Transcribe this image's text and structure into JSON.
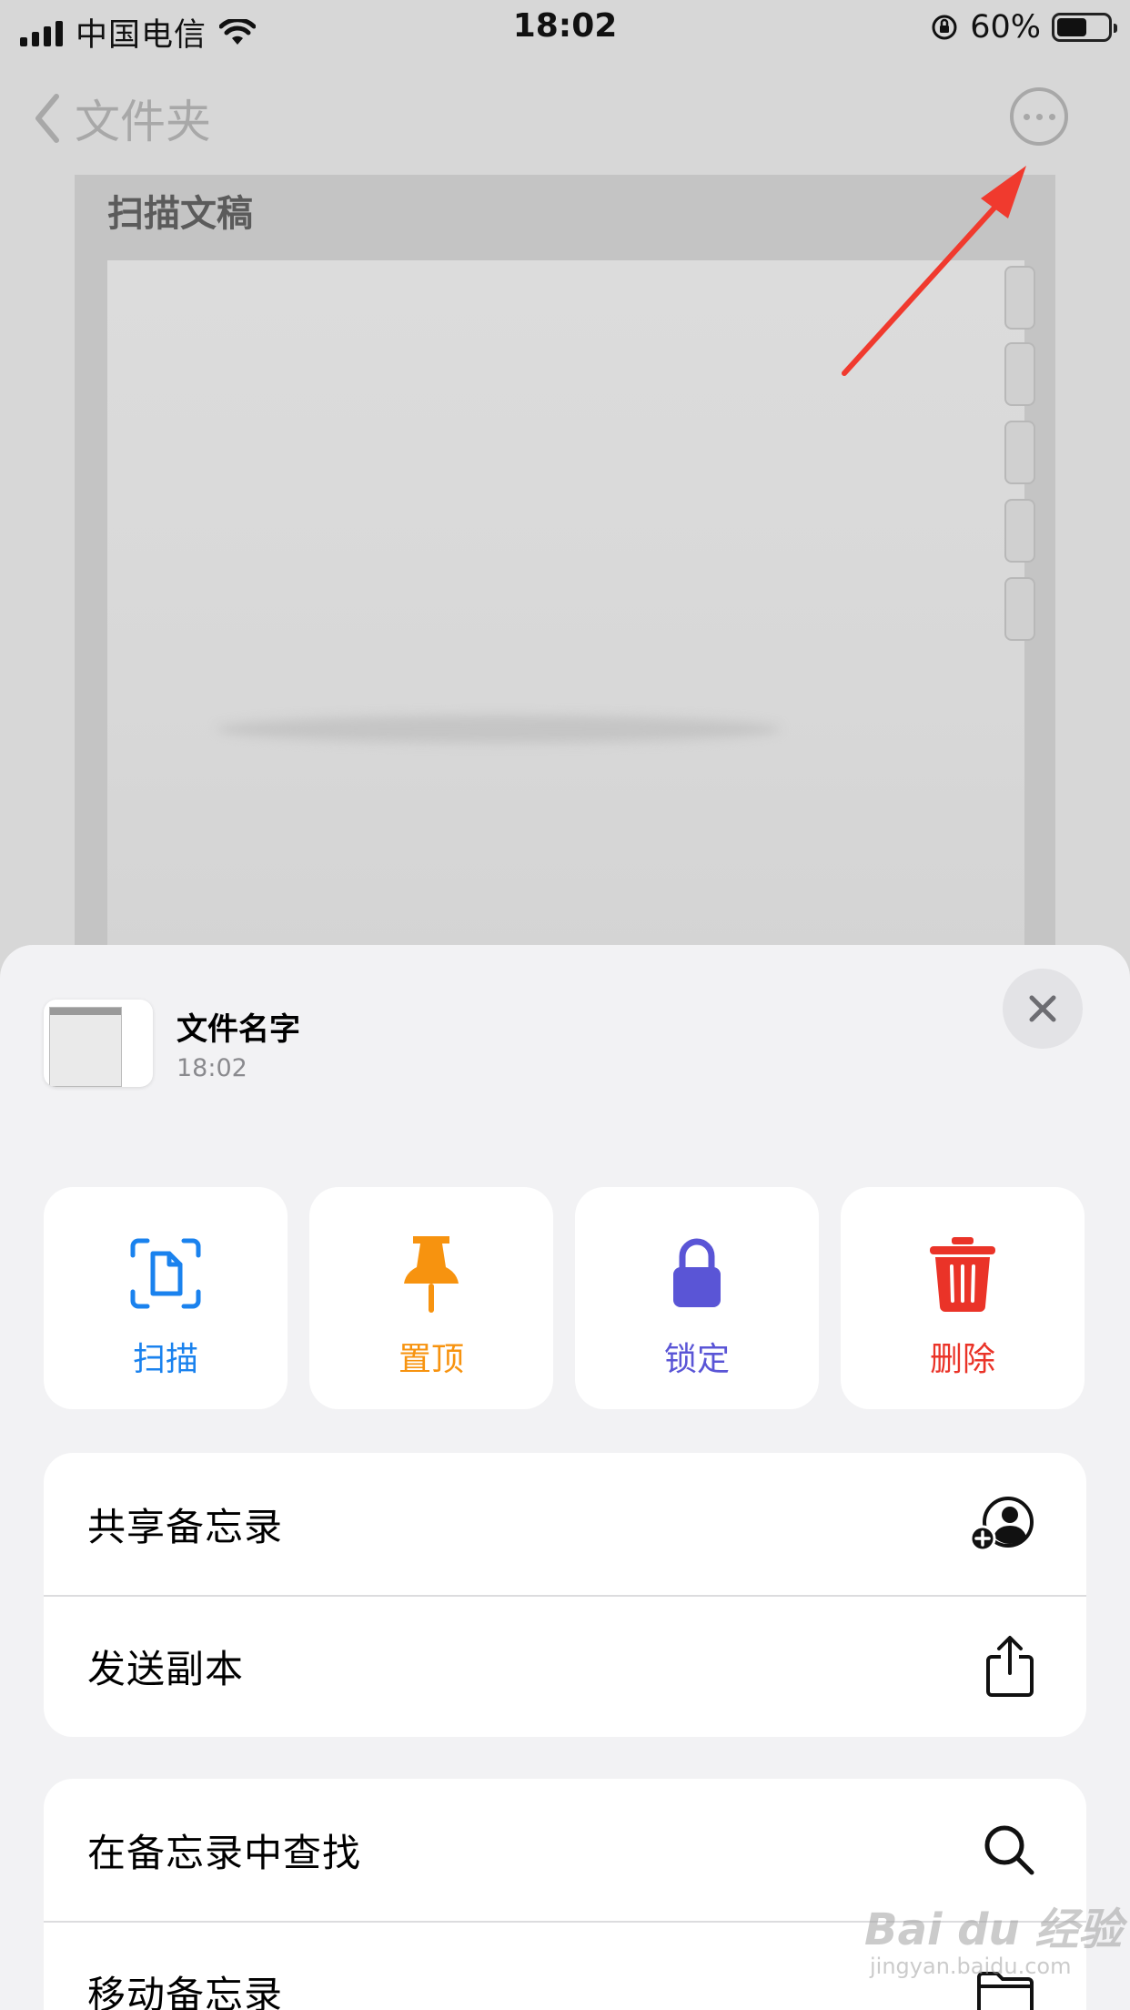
{
  "status_bar": {
    "carrier": "中国电信",
    "time": "18:02",
    "battery_percent": "60%",
    "battery_level": 0.6
  },
  "nav": {
    "back_label": "文件夹",
    "more_icon": "ellipsis-circle-icon"
  },
  "document": {
    "title": "扫描文稿"
  },
  "sheet": {
    "note_name": "文件名字",
    "note_time": "18:02",
    "actions": [
      {
        "label": "扫描",
        "icon": "scan-document-icon",
        "color": "#1a82ee"
      },
      {
        "label": "置顶",
        "icon": "pin-icon",
        "color": "#f7930f"
      },
      {
        "label": "锁定",
        "icon": "lock-icon",
        "color": "#5a55d6"
      },
      {
        "label": "删除",
        "icon": "trash-icon",
        "color": "#ea3328"
      }
    ],
    "group1": [
      {
        "label": "共享备忘录",
        "icon": "share-person-plus-icon"
      },
      {
        "label": "发送副本",
        "icon": "share-upload-icon"
      }
    ],
    "group2": [
      {
        "label": "在备忘录中查找",
        "icon": "search-icon"
      },
      {
        "label": "移动备忘录",
        "icon": "folder-icon"
      }
    ]
  },
  "colors": {
    "arrow": "#f03a2e",
    "sheet_bg": "#f2f2f4"
  }
}
